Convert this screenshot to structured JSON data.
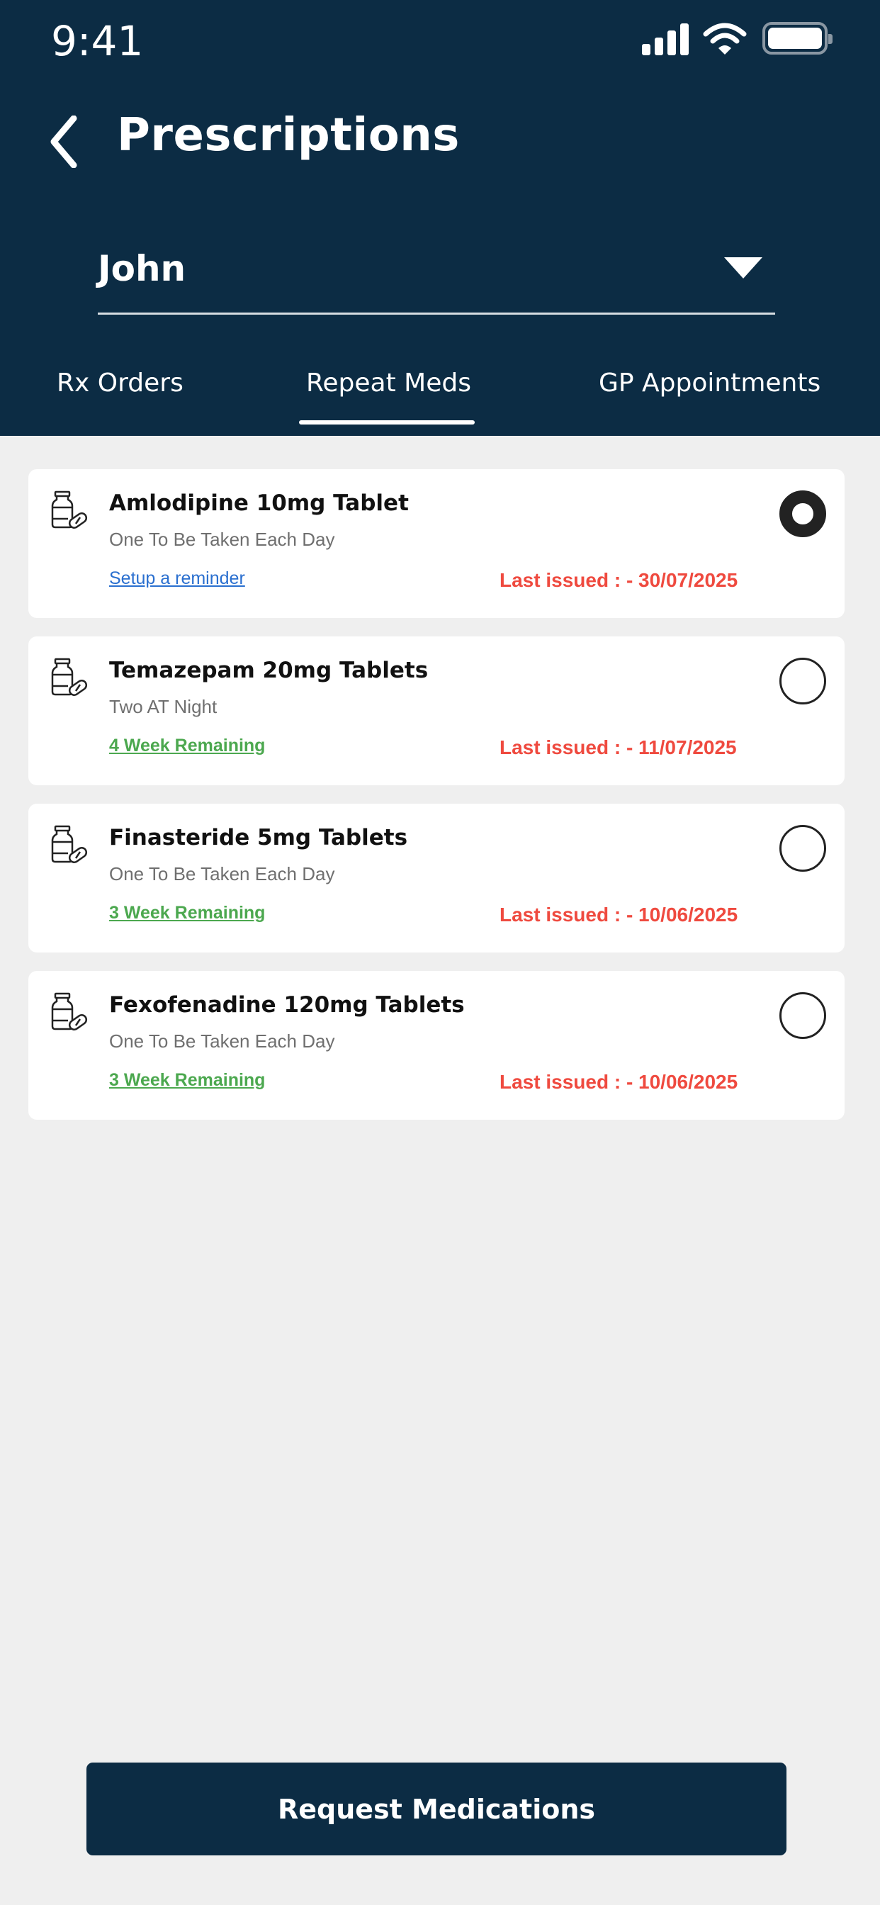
{
  "status_bar": {
    "time": "9:41",
    "icons": [
      "cellular-signal-icon",
      "wifi-icon",
      "battery-icon"
    ]
  },
  "header": {
    "back_icon": "chevron-left-icon",
    "title": "Prescriptions"
  },
  "patient_select": {
    "selected": "John",
    "caret_icon": "caret-down-icon"
  },
  "tabs": [
    {
      "label": "Rx Orders",
      "active": false
    },
    {
      "label": "Repeat Meds",
      "active": true
    },
    {
      "label": "GP Appointments",
      "active": false
    }
  ],
  "medications": [
    {
      "name": "Amlodipine 10mg Tablet",
      "dosage": "One To Be Taken Each Day",
      "action": "Setup a reminder",
      "action_type": "link",
      "last_issued": "Last issued : - 30/07/2025",
      "selected": true
    },
    {
      "name": "Temazepam 20mg Tablets",
      "dosage": "Two AT Night",
      "action": "4 Week Remaining",
      "action_type": "remaining",
      "last_issued": "Last issued : - 11/07/2025",
      "selected": false
    },
    {
      "name": "Finasteride 5mg Tablets",
      "dosage": "One To Be Taken Each Day",
      "action": "3 Week Remaining",
      "action_type": "remaining",
      "last_issued": "Last issued : - 10/06/2025",
      "selected": false
    },
    {
      "name": "Fexofenadine 120mg Tablets",
      "dosage": "One To Be Taken Each Day",
      "action": "3 Week Remaining",
      "action_type": "remaining",
      "last_issued": "Last issued : - 10/06/2025",
      "selected": false
    }
  ],
  "footer": {
    "request_button": "Request Medications"
  },
  "colors": {
    "header_bg": "#0c2c44",
    "page_bg": "#efefef",
    "last_issued": "#ef4a3f",
    "remaining": "#4ca84f",
    "link": "#2a6fcf"
  }
}
